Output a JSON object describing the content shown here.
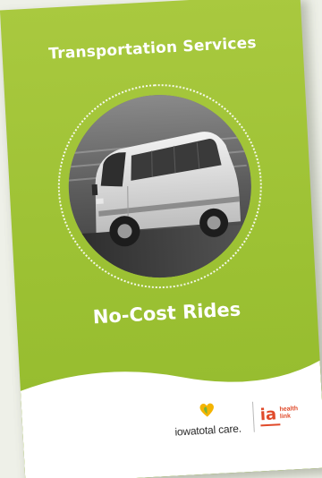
{
  "brochure": {
    "title": "Transportation Services",
    "subtitle": "No-Cost Rides",
    "background_color": "#9cc133",
    "footer_color": "#ffffff",
    "photo_description_icon": "van-photo"
  },
  "logos": {
    "iowa_total_care": {
      "text": "iowatotal care.",
      "mark_icon": "heart-leaf-icon",
      "color": "#f4b400"
    },
    "ia_health_link": {
      "letters": "ia",
      "line1": "health",
      "line2": "link",
      "color": "#e04a2a"
    }
  }
}
